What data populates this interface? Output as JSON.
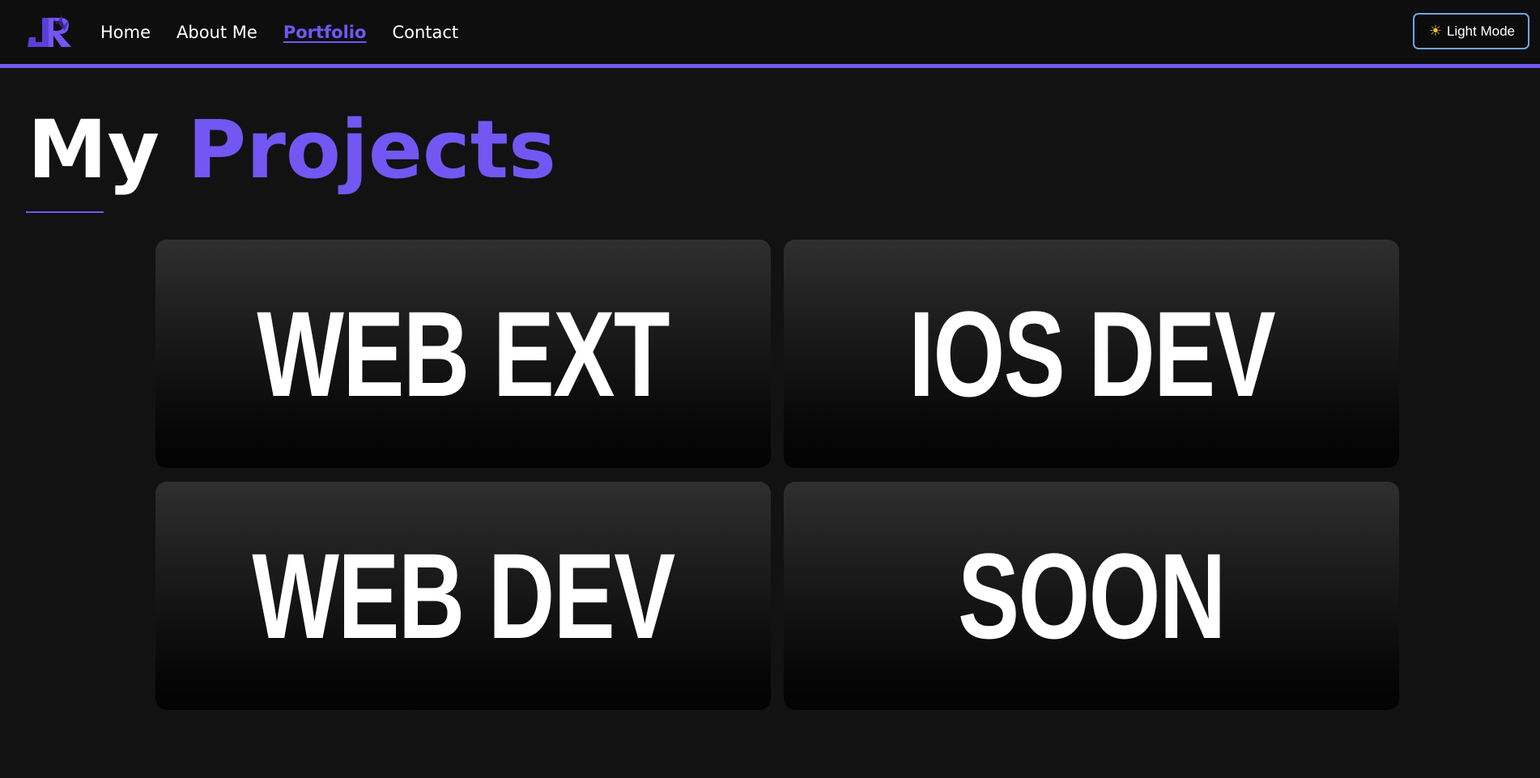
{
  "nav": {
    "logo_alt": "JR",
    "links": [
      {
        "label": "Home",
        "active": false
      },
      {
        "label": "About Me",
        "active": false
      },
      {
        "label": "Portfolio",
        "active": true
      },
      {
        "label": "Contact",
        "active": false
      }
    ],
    "theme_button": {
      "icon": "sun-icon",
      "label": "Light Mode"
    }
  },
  "page": {
    "title_first": "My",
    "title_accent": "Projects"
  },
  "projects": [
    {
      "label": "WEB EXT"
    },
    {
      "label": "IOS DEV"
    },
    {
      "label": "WEB DEV"
    },
    {
      "label": "SOON"
    }
  ],
  "colors": {
    "accent": "#7257f3",
    "background": "#121212",
    "button_border": "#6fa3e8"
  }
}
